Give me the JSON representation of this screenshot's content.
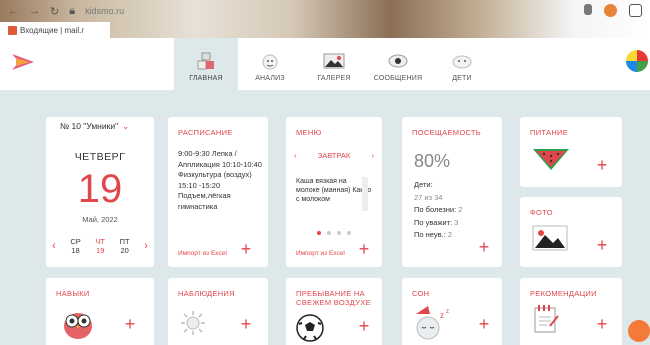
{
  "browser": {
    "url": "kidsmo.ru",
    "bookmark_label": "Входящие | mail.r"
  },
  "nav": {
    "items": [
      {
        "label": "ГЛАВНАЯ",
        "icon": "blocks-icon"
      },
      {
        "label": "АНАЛИЗ",
        "icon": "analysis-icon"
      },
      {
        "label": "ГАЛЕРЕЯ",
        "icon": "gallery-icon"
      },
      {
        "label": "СООБЩЕНИЯ",
        "icon": "messages-icon"
      },
      {
        "label": "ДЕТИ",
        "icon": "children-icon"
      }
    ]
  },
  "group_select": "№ 10 \"Умники\"",
  "calendar": {
    "weekday": "ЧЕТВЕРГ",
    "day": "19",
    "month": "Май, 2022",
    "week": [
      {
        "name": "СР",
        "num": "18"
      },
      {
        "name": "ЧТ",
        "num": "19"
      },
      {
        "name": "ПТ",
        "num": "20"
      }
    ]
  },
  "schedule": {
    "title": "РАСПИСАНИЕ",
    "text": "9:00-9:30 Лепка / Аппликация 10:10-10:40 Физкультура (воздух) 15:10 -15:20 Подъем,лёгкая гимнастика",
    "export": "Импорт из Excel"
  },
  "menu": {
    "title": "МЕНЮ",
    "meal": "ЗАВТРАК",
    "items": "Каша вязкая на молоке (манная) Какао с молоком",
    "export": "Импорт из Excel"
  },
  "attendance": {
    "title": "ПОСЕЩАЕМОСТЬ",
    "percent": "80%",
    "children_label": "Дети:",
    "children_value": "27 из 34",
    "sick_label": "По болезни:",
    "sick_value": "2",
    "valid_label": "По уважит:",
    "valid_value": "3",
    "invalid_label": "По неув.:",
    "invalid_value": "2"
  },
  "nutrition": {
    "title": "ПИТАНИЕ"
  },
  "photo": {
    "title": "ФОТО"
  },
  "skills": {
    "title": "НАВЫКИ"
  },
  "observations": {
    "title": "НАБЛЮДЕНИЯ"
  },
  "outdoor": {
    "title": "ПРЕБЫВАНИЕ НА СВЕЖЕМ ВОЗДУХЕ"
  },
  "sleep": {
    "title": "СОН"
  },
  "recommendations": {
    "title": "РЕКОМЕНДАЦИИ"
  },
  "colors": {
    "accent": "#e0474c",
    "background": "#dde8ea"
  }
}
